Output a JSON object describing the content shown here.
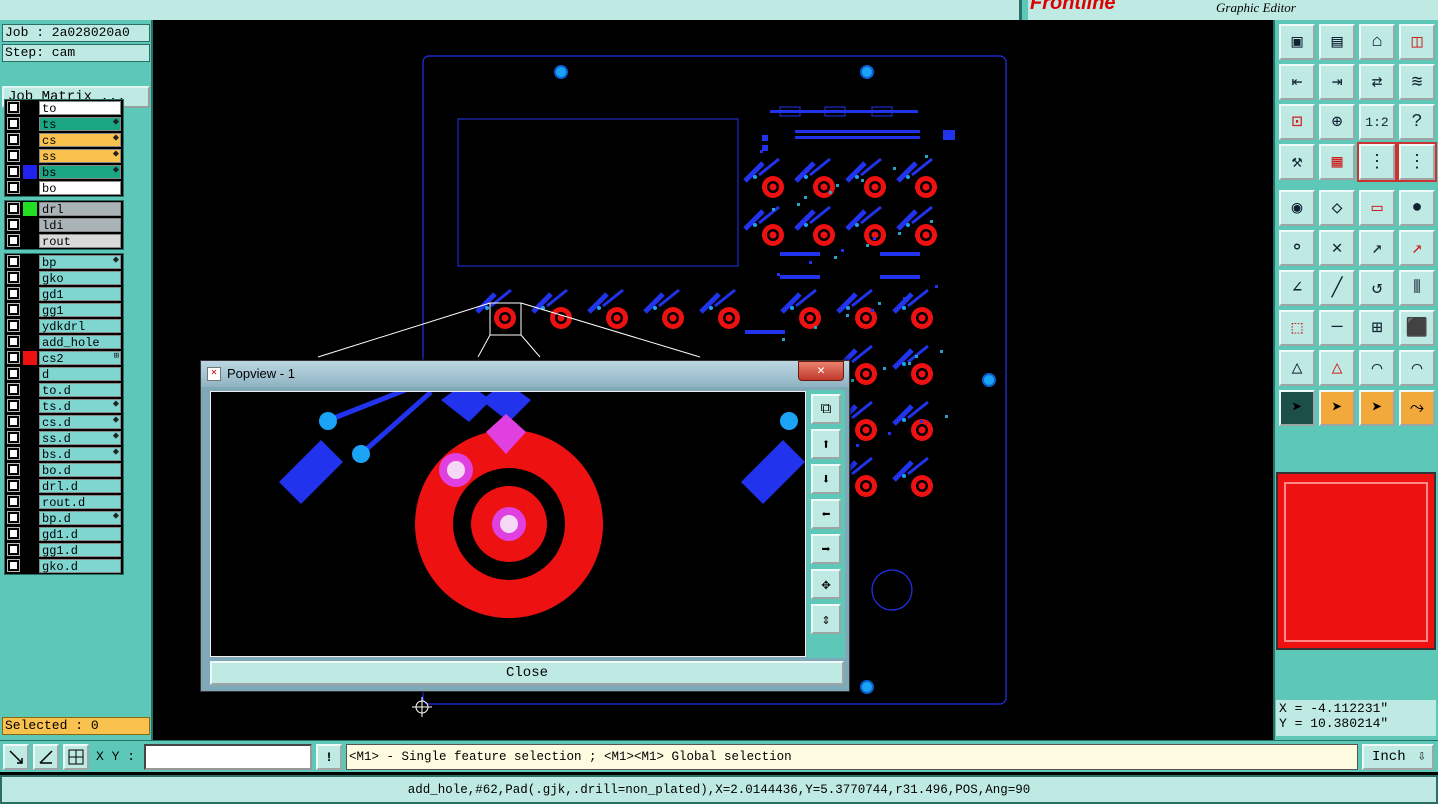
{
  "header": {
    "app_subtitle": "Graphic Editor"
  },
  "job": {
    "job_label": "Job : 2a028020a0",
    "step_label": "Step: cam",
    "matrix_button": "Job Matrix ..."
  },
  "layers_group1": [
    {
      "name": "to",
      "swatch": "#000000",
      "bg": "#ffffff",
      "mark": ""
    },
    {
      "name": "ts",
      "swatch": "#000000",
      "bg": "#1aa583",
      "mark": "⬥"
    },
    {
      "name": "cs",
      "swatch": "#000000",
      "bg": "#f9c14e",
      "mark": "⬥"
    },
    {
      "name": "ss",
      "swatch": "#000000",
      "bg": "#f9c14e",
      "mark": "⬥"
    },
    {
      "name": "bs",
      "swatch": "#2222ee",
      "bg": "#1aa583",
      "mark": "⬥"
    },
    {
      "name": "bo",
      "swatch": "#000000",
      "bg": "#ffffff",
      "mark": ""
    }
  ],
  "layers_group2": [
    {
      "name": "drl",
      "swatch": "#22dd22",
      "bg": "#a9b3b8",
      "mark": ""
    },
    {
      "name": "ldi",
      "swatch": "#000000",
      "bg": "#a9b3b8",
      "mark": ""
    },
    {
      "name": "rout",
      "swatch": "#000000",
      "bg": "#d9d9d9",
      "mark": ""
    }
  ],
  "layers_group3": [
    {
      "name": "bp",
      "swatch": "#000000",
      "bg": "#7fd6d0",
      "mark": "⬥"
    },
    {
      "name": "gko",
      "swatch": "#000000",
      "bg": "#7fd6d0",
      "mark": ""
    },
    {
      "name": "gd1",
      "swatch": "#000000",
      "bg": "#7fd6d0",
      "mark": ""
    },
    {
      "name": "gg1",
      "swatch": "#000000",
      "bg": "#7fd6d0",
      "mark": ""
    },
    {
      "name": "ydkdrl",
      "swatch": "#000000",
      "bg": "#7fd6d0",
      "mark": ""
    },
    {
      "name": "add_hole",
      "swatch": "#000000",
      "bg": "#7fd6d0",
      "mark": ""
    },
    {
      "name": "cs2",
      "swatch": "#ee1111",
      "bg": "#7fd6d0",
      "mark": "⊞"
    },
    {
      "name": "d",
      "swatch": "#000000",
      "bg": "#7fd6d0",
      "mark": ""
    },
    {
      "name": "to.d",
      "swatch": "#000000",
      "bg": "#7fd6d0",
      "mark": ""
    },
    {
      "name": "ts.d",
      "swatch": "#000000",
      "bg": "#7fd6d0",
      "mark": "⬥"
    },
    {
      "name": "cs.d",
      "swatch": "#000000",
      "bg": "#7fd6d0",
      "mark": "⬥"
    },
    {
      "name": "ss.d",
      "swatch": "#000000",
      "bg": "#7fd6d0",
      "mark": "⬥"
    },
    {
      "name": "bs.d",
      "swatch": "#000000",
      "bg": "#7fd6d0",
      "mark": "⬥"
    },
    {
      "name": "bo.d",
      "swatch": "#000000",
      "bg": "#7fd6d0",
      "mark": ""
    },
    {
      "name": "drl.d",
      "swatch": "#000000",
      "bg": "#7fd6d0",
      "mark": ""
    },
    {
      "name": "rout.d",
      "swatch": "#000000",
      "bg": "#7fd6d0",
      "mark": ""
    },
    {
      "name": "bp.d",
      "swatch": "#000000",
      "bg": "#7fd6d0",
      "mark": "⬥"
    },
    {
      "name": "gd1.d",
      "swatch": "#000000",
      "bg": "#7fd6d0",
      "mark": ""
    },
    {
      "name": "gg1.d",
      "swatch": "#000000",
      "bg": "#7fd6d0",
      "mark": ""
    },
    {
      "name": "gko.d",
      "swatch": "#000000",
      "bg": "#7fd6d0",
      "mark": ""
    }
  ],
  "selected_label": "Selected : 0",
  "popup": {
    "title": "Popview - 1",
    "close_label": "Close",
    "close_x": "✕"
  },
  "coordinates": {
    "x": "X = -4.112231\"",
    "y": "Y = 10.380214\""
  },
  "bottom": {
    "xy_label": "X Y :",
    "xy_value": "",
    "warn_glyph": "!",
    "message": "<M1> - Single feature selection ; <M1><M1> Global selection",
    "unit": "Inch"
  },
  "status_line": "add_hole,#62,Pad(.gjk,.drill=non_plated),X=2.0144436,Y=5.3770744,r31.496,POS,Ang=90",
  "toolbar_icons": [
    "open-icon",
    "save-icon",
    "home-icon",
    "window-icon",
    "import-icon",
    "export-icon",
    "swap-icon",
    "snake-icon",
    "fit-icon",
    "zoom-fit-icon",
    "scale-1-2-icon",
    "help-icon",
    "tools-icon",
    "grid-icon",
    "layers-icon",
    "layers-active-icon",
    "pad-add-icon",
    "polygon-icon",
    "ruler-icon",
    "circle-icon",
    "join-icon",
    "cross-icon",
    "move-point-icon",
    "point-icon",
    "angle-icon",
    "line-icon",
    "arc-icon",
    "mirror-icon",
    "select-box-icon",
    "cut-icon",
    "measure-icon",
    "shapes-icon",
    "triangle-icon",
    "triangle-up-icon",
    "arch-icon",
    "arch-cross-icon",
    "pointer-icon",
    "pointer-box-icon",
    "pointer-circle-icon",
    "route-icon"
  ],
  "colors": {
    "panel": "#5ec8b8",
    "button": "#bfeae4",
    "accent": "#f2a93b",
    "copper": "#ee1111",
    "outline": "#2233ee"
  }
}
